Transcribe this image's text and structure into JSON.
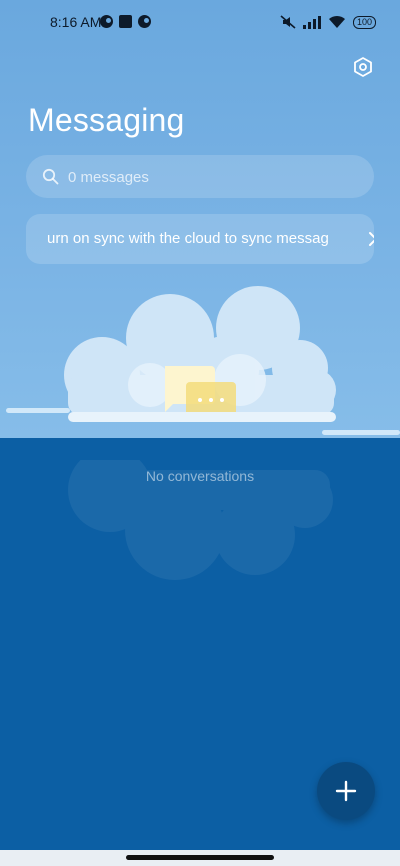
{
  "status_bar": {
    "time": "8:16 AM",
    "battery": "100",
    "icons": [
      "app-notification-icon",
      "square-notification-icon",
      "app-notification-icon",
      "mute-icon",
      "signal-icon",
      "wifi-icon",
      "battery-icon"
    ]
  },
  "header": {
    "title": "Messaging",
    "settings_icon": "settings-icon"
  },
  "search": {
    "placeholder": "0 messages",
    "icon": "search-icon"
  },
  "sync_banner": {
    "text": "urn on sync with the cloud to sync messages",
    "icon": "chevron-right-icon"
  },
  "empty_state": {
    "text": "No conversations",
    "illustration": "cloud-with-message-bubbles"
  },
  "fab": {
    "icon": "plus-icon"
  },
  "colors": {
    "top_background": "#7bb4e5",
    "bottom_background": "#0c5fa4",
    "fab": "#0a4a80"
  }
}
